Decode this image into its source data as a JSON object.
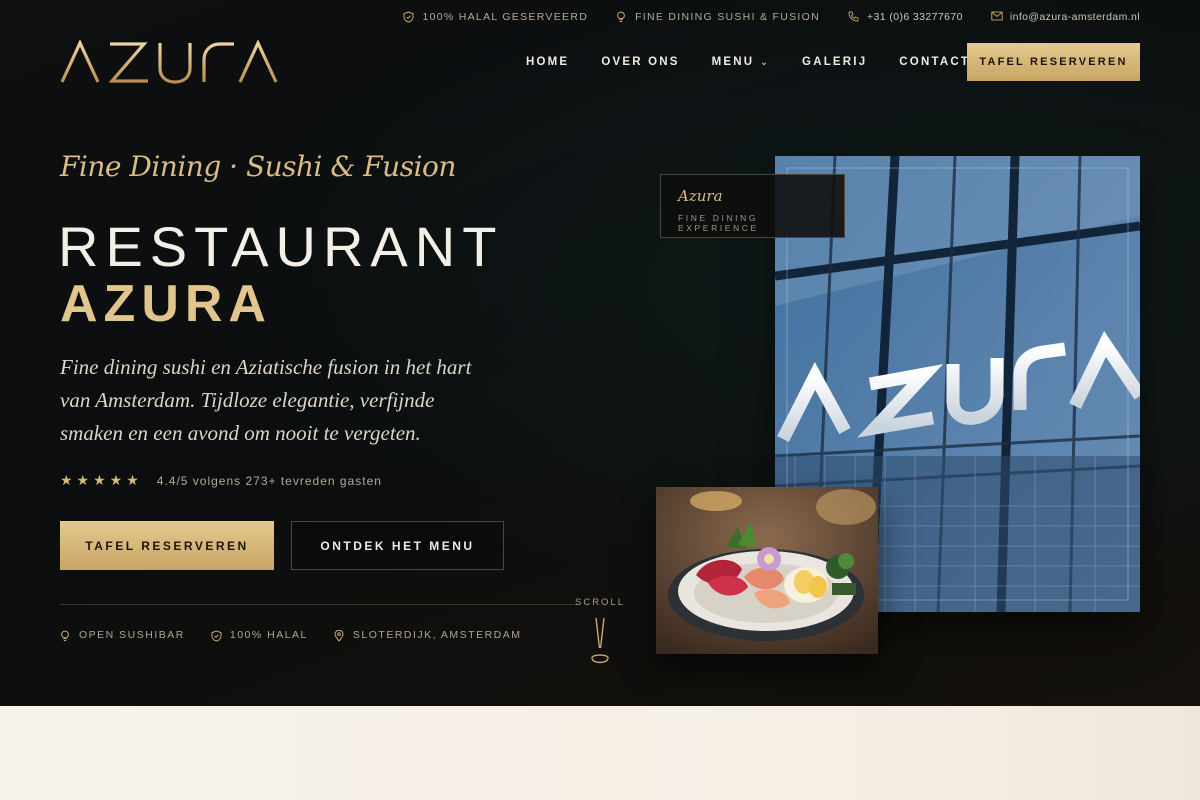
{
  "topbar": {
    "halal": "100% HALAL GESERVEERD",
    "dining": "FINE DINING SUSHI & FUSION",
    "phone": "+31 (0)6 33277670",
    "email": "info@azura-amsterdam.nl"
  },
  "brand": {
    "logo_text": "AZURA"
  },
  "nav": {
    "items": [
      "HOME",
      "OVER ONS",
      "MENU",
      "GALERIJ",
      "CONTACT"
    ],
    "cta": "TAFEL RESERVEREN"
  },
  "hero": {
    "script": "Fine Dining · Sushi & Fusion",
    "title_line1": "RESTAURANT",
    "title_line2": "AZURA",
    "lead": "Fine dining sushi en Aziatische fusion in het hart van Amsterdam. Tijdloze elegantie, verfijnde smaken en een avond om nooit te vergeten.",
    "rating": {
      "stars": 5,
      "text": "4.4/5 volgens 273+ tevreden gasten"
    },
    "cta_primary": "TAFEL RESERVEREN",
    "cta_secondary": "ONTDEK HET MENU",
    "features": [
      "OPEN SUSHIBAR",
      "100% HALAL",
      "SLOTERDIJK, AMSTERDAM"
    ],
    "scroll_label": "SCROLL"
  },
  "badge": {
    "name": "Azura",
    "subtitle": "FINE DINING EXPERIENCE"
  },
  "colors": {
    "gold": "#d9bb84",
    "gold_button": "#d6b677",
    "dark": "#0c0e10",
    "cream": "#f6f1e9"
  }
}
